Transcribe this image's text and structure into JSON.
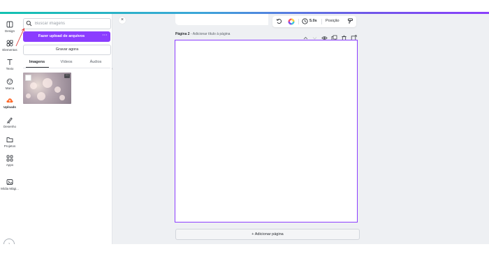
{
  "rail": {
    "items": [
      {
        "label": "Design",
        "icon": "layout-icon"
      },
      {
        "label": "Elementos",
        "icon": "shapes-icon"
      },
      {
        "label": "Texto",
        "icon": "text-icon"
      },
      {
        "label": "Marca",
        "icon": "crown-icon"
      },
      {
        "label": "Uploads",
        "icon": "cloud-upload-icon"
      },
      {
        "label": "Desenho",
        "icon": "pen-icon"
      },
      {
        "label": "Projetos",
        "icon": "folder-icon"
      },
      {
        "label": "Apps",
        "icon": "apps-icon"
      },
      {
        "label": "Mídia Mági...",
        "icon": "magic-media-icon"
      }
    ]
  },
  "panel": {
    "search_placeholder": "Buscar imagens",
    "upload_button": "Fazer upload de arquivos",
    "upload_more": "···",
    "record_button": "Gravar agora",
    "tabs": [
      {
        "label": "Imagens",
        "active": true
      },
      {
        "label": "Vídeos",
        "active": false
      },
      {
        "label": "Áudios",
        "active": false
      }
    ]
  },
  "toolbar": {
    "duration": "5.0s",
    "position": "Posição"
  },
  "page": {
    "title": "Página 2",
    "title_placeholder": " - Adicionar título à página"
  },
  "add_page": "+ Adicionar página",
  "colors": {
    "accent": "#8b3dff",
    "topbar_start": "#12c2b0",
    "topbar_end": "#8a3ffc",
    "annotation_arrow": "#e03b3b"
  }
}
